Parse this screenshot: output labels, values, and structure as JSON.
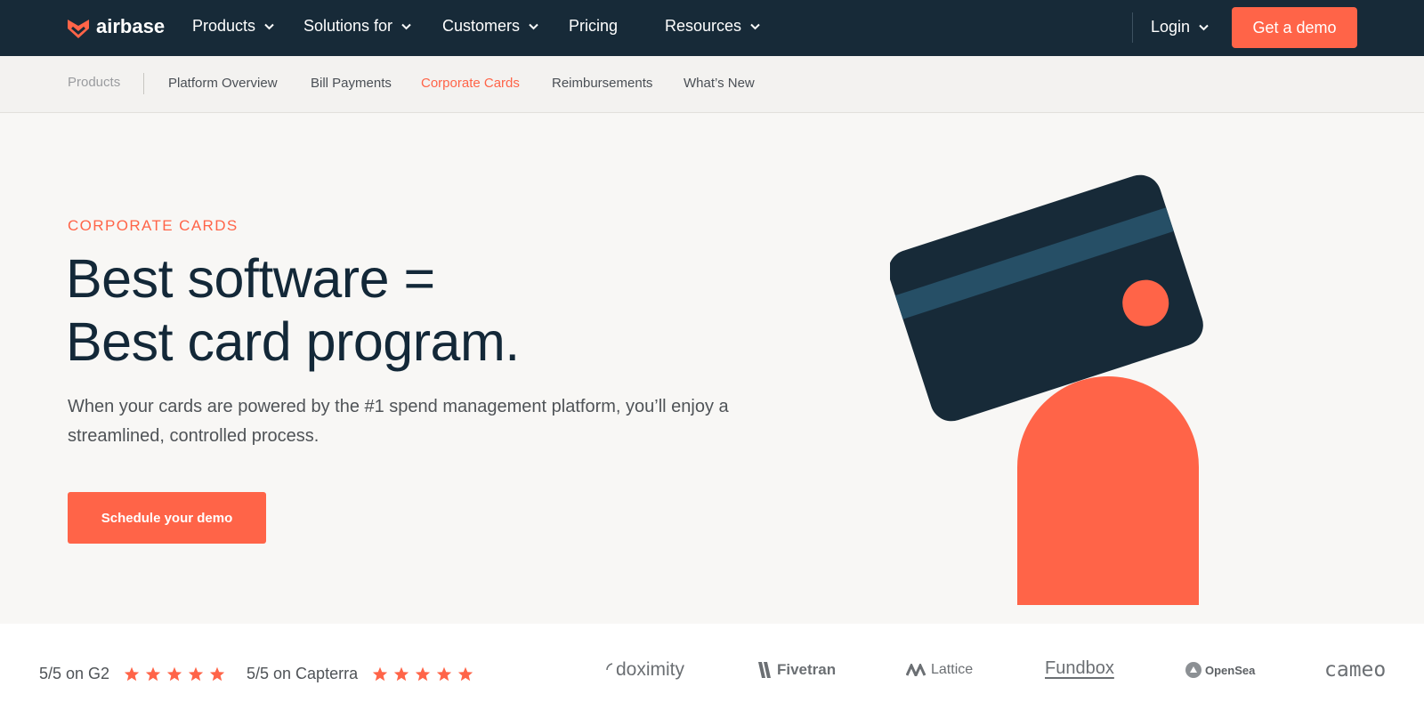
{
  "brand": {
    "name": "airbase",
    "color": "#ff6448",
    "dark": "#172a38"
  },
  "topnav": {
    "items": [
      {
        "label": "Products",
        "has_dropdown": true
      },
      {
        "label": "Solutions for",
        "has_dropdown": true
      },
      {
        "label": "Customers",
        "has_dropdown": true
      },
      {
        "label": "Pricing",
        "has_dropdown": false
      },
      {
        "label": "Resources",
        "has_dropdown": true
      }
    ],
    "login_label": "Login",
    "demo_label": "Get a demo"
  },
  "subnav": {
    "section_label": "Products",
    "items": [
      {
        "label": "Platform Overview",
        "active": false
      },
      {
        "label": "Bill Payments",
        "active": false
      },
      {
        "label": "Corporate Cards",
        "active": true
      },
      {
        "label": "Reimbursements",
        "active": false
      },
      {
        "label": "What’s New",
        "active": false
      }
    ]
  },
  "hero": {
    "eyebrow": "CORPORATE CARDS",
    "headline_line1": "Best software =",
    "headline_line2": "Best card program.",
    "subcopy": "When your cards are powered by the #1 spend management platform, you’ll enjoy a streamlined, controlled process.",
    "cta_label": "Schedule your demo",
    "illustration_icon": "credit-card-illustration"
  },
  "ratings": [
    {
      "label": "5/5 on G2",
      "stars": 5
    },
    {
      "label": "5/5 on Capterra",
      "stars": 5
    }
  ],
  "customer_logos": [
    "doximity",
    "Fivetran",
    "Lattice",
    "Fundbox",
    "OpenSea",
    "cameo"
  ]
}
